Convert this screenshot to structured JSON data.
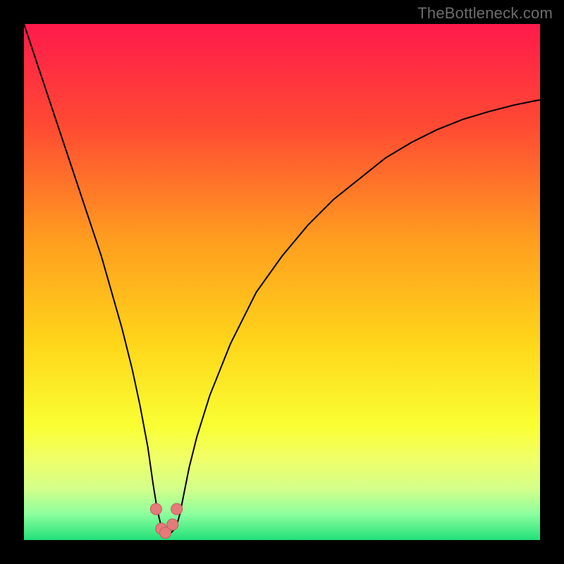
{
  "watermark": "TheBottleneck.com",
  "colors": {
    "frame": "#000000",
    "gradient_stops": [
      {
        "offset": 0.0,
        "color": "#ff1a4b"
      },
      {
        "offset": 0.2,
        "color": "#ff4b33"
      },
      {
        "offset": 0.42,
        "color": "#ff9e1f"
      },
      {
        "offset": 0.62,
        "color": "#ffd61a"
      },
      {
        "offset": 0.78,
        "color": "#f9ff33"
      },
      {
        "offset": 0.84,
        "color": "#f1ff66"
      },
      {
        "offset": 0.9,
        "color": "#d4ff8a"
      },
      {
        "offset": 0.95,
        "color": "#8cff9e"
      },
      {
        "offset": 1.0,
        "color": "#22e07a"
      }
    ],
    "curve": "#000000",
    "marker_fill": "#e47a7a",
    "marker_stroke": "#c85a5a"
  },
  "chart_data": {
    "type": "line",
    "title": "",
    "xlabel": "",
    "ylabel": "",
    "xlim": [
      0,
      100
    ],
    "ylim": [
      0,
      100
    ],
    "series": [
      {
        "name": "bottleneck-curve",
        "x": [
          0,
          3,
          6,
          9,
          12,
          15,
          17,
          19,
          21,
          22.5,
          24,
          25,
          25.8,
          26.5,
          27,
          27.5,
          28.5,
          29.5,
          30.2,
          31,
          32,
          33.5,
          36,
          40,
          45,
          50,
          55,
          60,
          65,
          70,
          75,
          80,
          85,
          90,
          95,
          100
        ],
        "y": [
          100,
          91,
          82,
          73,
          64,
          55,
          48,
          41,
          33,
          26,
          18,
          11,
          6,
          3,
          1.5,
          1.2,
          1.4,
          2.5,
          5,
          9,
          14,
          20,
          28,
          38,
          48,
          55,
          61,
          66,
          70,
          74,
          77,
          79.5,
          81.5,
          83,
          84.3,
          85.3
        ]
      }
    ],
    "markers": {
      "name": "highlight-points",
      "x": [
        25.6,
        26.6,
        27.4,
        28.8,
        29.6
      ],
      "y": [
        6.0,
        2.2,
        1.4,
        3.0,
        6.0
      ]
    }
  }
}
